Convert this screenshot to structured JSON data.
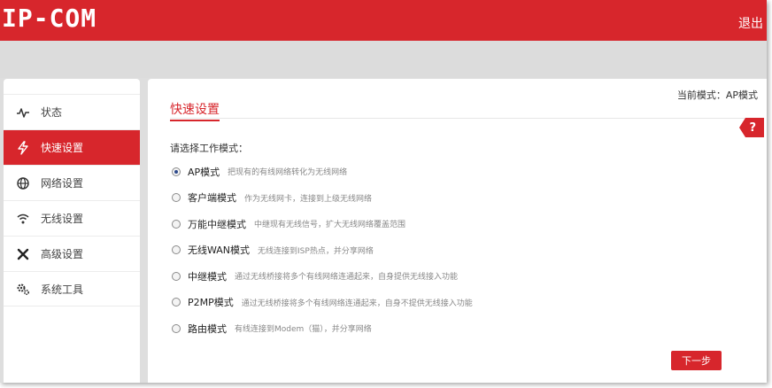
{
  "header": {
    "logo": "IP-COM",
    "logout": "退出"
  },
  "sidebar": {
    "items": [
      {
        "label": "状态",
        "icon": "pulse-icon"
      },
      {
        "label": "快速设置",
        "icon": "lightning-icon",
        "active": true
      },
      {
        "label": "网络设置",
        "icon": "globe-icon"
      },
      {
        "label": "无线设置",
        "icon": "wifi-icon"
      },
      {
        "label": "高级设置",
        "icon": "tools-icon"
      },
      {
        "label": "系统工具",
        "icon": "gears-icon"
      }
    ]
  },
  "main": {
    "current_mode": "当前模式：AP模式",
    "title": "快速设置",
    "help": "?",
    "prompt": "请选择工作模式：",
    "options": [
      {
        "name": "AP模式",
        "desc": "把现有的有线网络转化为无线网络",
        "checked": true
      },
      {
        "name": "客户端模式",
        "desc": "作为无线网卡，连接到上级无线网络"
      },
      {
        "name": "万能中继模式",
        "desc": "中继现有无线信号，扩大无线网络覆盖范围"
      },
      {
        "name": "无线WAN模式",
        "desc": "无线连接到ISP热点，并分享网络"
      },
      {
        "name": "中继模式",
        "desc": "通过无线桥接将多个有线网络连通起来，自身提供无线接入功能"
      },
      {
        "name": "P2MP模式",
        "desc": "通过无线桥接将多个有线网络连通起来，自身不提供无线接入功能"
      },
      {
        "name": "路由模式",
        "desc": "有线连接到Modem（猫），并分享网络"
      }
    ],
    "next_button": "下一步"
  },
  "colors": {
    "brand_red": "#d7262c",
    "radio_dot": "#2e4a8b"
  }
}
